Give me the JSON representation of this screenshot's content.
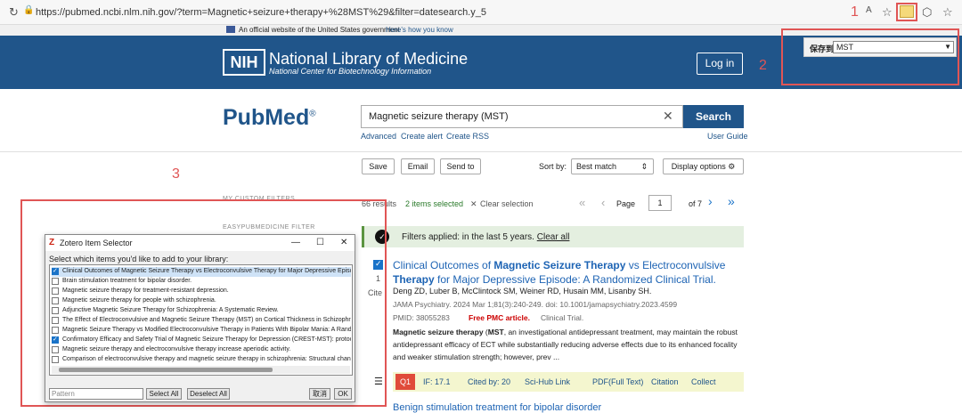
{
  "browser": {
    "url": "https://pubmed.ncbi.nlm.nih.gov/?term=Magnetic+seizure+therapy+%28MST%29&filter=datesearch.y_5"
  },
  "gov_banner": {
    "text": "An official website of the United States government",
    "link": "Here's how you know"
  },
  "nih": {
    "logo": "NIH",
    "title": "National Library of Medicine",
    "subtitle": "National Center for Biotechnology Information",
    "login": "Log in"
  },
  "zotero_save": {
    "label": "保存到",
    "collection": "MST"
  },
  "annotations": {
    "one": "1",
    "two": "2",
    "three": "3"
  },
  "pubmed": {
    "logo_pub": "Pub",
    "logo_med": "Med",
    "logo_reg": "®",
    "search_value": "Magnetic seizure therapy (MST)",
    "search_button": "Search",
    "advanced": "Advanced",
    "create_alert": "Create alert",
    "create_rss": "Create RSS",
    "user_guide": "User Guide"
  },
  "toolbar": {
    "save": "Save",
    "email": "Email",
    "send_to": "Send to",
    "sort_by": "Sort by:",
    "sort_value": "Best match",
    "display_options": "Display options"
  },
  "results": {
    "count": "66 results",
    "selected": "2 items selected",
    "clear_selection": "Clear selection",
    "page_label": "Page",
    "page": "1",
    "of": "of 7",
    "my_custom_filters": "MY CUSTOM FILTERS",
    "easypub_filter": "EASYPUBMEDICINE FILTER",
    "filters_applied": "Filters applied: in the last 5 years.",
    "clear_all": "Clear all",
    "item_index": "1",
    "cite": "Cite"
  },
  "article": {
    "title_pre": "Clinical Outcomes of ",
    "title_b1": "Magnetic Seizure Therapy",
    "title_mid": " vs Electroconvulsive ",
    "title_b2": "Therapy",
    "title_post": " for Major Depressive Episode: A Randomized Clinical Trial.",
    "authors": "Deng ZD, Luber B, McClintock SM, Weiner RD, Husain MM, Lisanby SH.",
    "journal": "JAMA Psychiatry. 2024 Mar 1;81(3):240-249. doi: 10.1001/jamapsychiatry.2023.4599",
    "pmid": "PMID: 38055283",
    "pmc": "Free PMC article.",
    "type": "Clinical Trial.",
    "abstract_b": "Magnetic seizure therapy",
    "abstract_mst": "MST",
    "abstract_rest": ", an investigational antidepressant treatment, may maintain the robust antidepressant efficacy of ECT while substantially reducing adverse effects due to its enhanced focality and weaker stimulation strength; however, prev ...",
    "q": "Q1",
    "if": "IF:  17.1",
    "cited": "Cited by:  20",
    "scihub": "Sci-Hub Link",
    "pdf": "PDF(Full Text)",
    "citation": "Citation",
    "collect": "Collect",
    "next_title": "Benign stimulation treatment for bipolar disorder"
  },
  "zotero_dialog": {
    "title": "Zotero Item Selector",
    "prompt": "Select which items you'd like to add to your library:",
    "items": [
      {
        "label": "Clinical Outcomes of Magnetic Seizure Therapy vs Electroconvulsive Therapy for Major Depressive Episode: A Randomized Clinical Trial.",
        "checked": true
      },
      {
        "label": "Brain stimulation treatment for bipolar disorder.",
        "checked": false
      },
      {
        "label": "Magnetic seizure therapy for treatment-resistant depression.",
        "checked": false
      },
      {
        "label": "Magnetic seizure therapy for people with schizophrenia.",
        "checked": false
      },
      {
        "label": "Adjunctive Magnetic Seizure Therapy for Schizophrenia: A Systematic Review.",
        "checked": false
      },
      {
        "label": "The Effect of Electroconvulsive and Magnetic Seizure Therapy (MST) on Cortical Thickness in Schizophrenia",
        "checked": false
      },
      {
        "label": "Magnetic Seizure Therapy vs Modified Electroconvulsive Therapy in Patients With Bipolar Mania: A Randomized",
        "checked": false
      },
      {
        "label": "Confirmatory Efficacy and Safety Trial of Magnetic Seizure Therapy for Depression (CREST-MST): protocol",
        "checked": true
      },
      {
        "label": "Magnetic seizure therapy and electroconvulsive therapy increase aperiodic activity.",
        "checked": false
      },
      {
        "label": "Comparison of electroconvulsive therapy and magnetic seizure therapy in schizophrenia: Structural changes",
        "checked": false
      }
    ],
    "pattern_placeholder": "Pattern",
    "select_all": "Select All",
    "deselect_all": "Deselect All",
    "cancel": "取消",
    "ok": "OK"
  },
  "colors": {
    "nih_blue": "#20558a",
    "annotation_red": "#e05555",
    "link_blue": "#1e64b4",
    "q1_red": "#e04b3a"
  }
}
